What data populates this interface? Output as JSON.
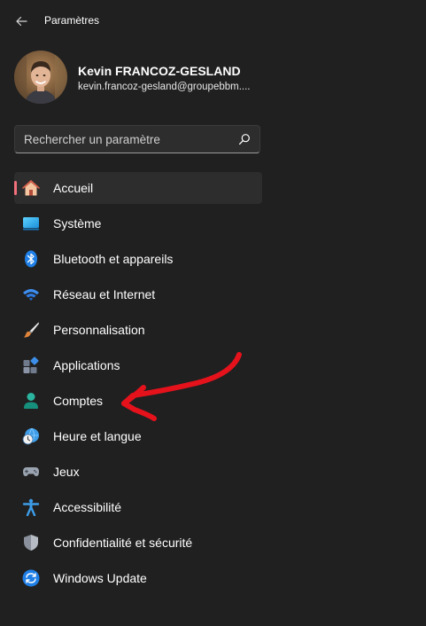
{
  "window": {
    "title": "Paramètres"
  },
  "user": {
    "name": "Kevin FRANCOZ-GESLAND",
    "email": "kevin.francoz-gesland@groupebbm...."
  },
  "search": {
    "placeholder": "Rechercher un paramètre"
  },
  "nav": {
    "items": [
      {
        "label": "Accueil",
        "icon": "home-icon",
        "selected": true
      },
      {
        "label": "Système",
        "icon": "system-icon"
      },
      {
        "label": "Bluetooth et appareils",
        "icon": "bluetooth-icon"
      },
      {
        "label": "Réseau et Internet",
        "icon": "wifi-icon"
      },
      {
        "label": "Personnalisation",
        "icon": "brush-icon"
      },
      {
        "label": "Applications",
        "icon": "apps-icon"
      },
      {
        "label": "Comptes",
        "icon": "account-icon"
      },
      {
        "label": "Heure et langue",
        "icon": "clock-globe-icon"
      },
      {
        "label": "Jeux",
        "icon": "gamepad-icon"
      },
      {
        "label": "Accessibilité",
        "icon": "accessibility-icon"
      },
      {
        "label": "Confidentialité et sécurité",
        "icon": "shield-icon"
      },
      {
        "label": "Windows Update",
        "icon": "windows-update-icon"
      }
    ]
  },
  "colors": {
    "background": "#202020",
    "selected_item": "#2d2d2d",
    "selection_indicator": "#f2707b",
    "annotation_arrow": "#e5121c"
  }
}
